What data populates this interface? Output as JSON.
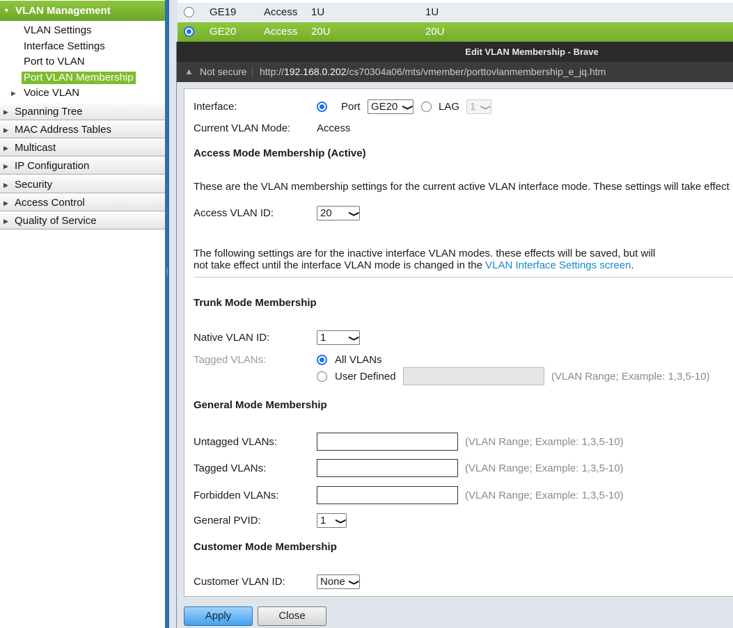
{
  "sidebar": {
    "active_section": "VLAN Management",
    "sub_items": [
      "VLAN Settings",
      "Interface Settings",
      "Port to VLAN",
      "Port VLAN Membership",
      "Voice VLAN"
    ],
    "sections": [
      "Spanning Tree",
      "MAC Address Tables",
      "Multicast",
      "IP Configuration",
      "Security",
      "Access Control",
      "Quality of Service"
    ]
  },
  "table": {
    "rows": [
      {
        "port": "GE19",
        "mode": "Access",
        "admin": "1U",
        "oper": "1U",
        "selected": false
      },
      {
        "port": "GE20",
        "mode": "Access",
        "admin": "20U",
        "oper": "20U",
        "selected": true
      }
    ]
  },
  "popup": {
    "title": "Edit VLAN Membership - Brave",
    "not_secure": "Not secure",
    "url_prefix": "http://",
    "url_host": "192.168.0.202",
    "url_path": "/cs70304a06/mts/vmember/porttovlanmembership_e_jq.htm"
  },
  "form": {
    "interface_label": "Interface:",
    "port_label": "Port",
    "port_value": "GE20",
    "lag_label": "LAG",
    "lag_value": "1",
    "current_mode_label": "Current VLAN Mode:",
    "current_mode_value": "Access",
    "access_head": "Access Mode Membership (Active)",
    "access_desc": "These are the VLAN membership settings for the current active VLAN interface mode. These settings will take effect i",
    "access_vlan_label": "Access VLAN ID:",
    "access_vlan_value": "20",
    "inactive_desc_1": "The following settings are for the inactive interface VLAN modes. these effects will be saved, but will",
    "inactive_desc_2": "not take effect until the interface VLAN mode is changed in the",
    "inactive_link": "VLAN Interface Settings screen",
    "inactive_period": ".",
    "trunk_head": "Trunk Mode Membership",
    "native_vlan_label": "Native VLAN ID:",
    "native_vlan_value": "1",
    "tagged_vlans_label": "Tagged VLANs:",
    "all_vlans_label": "All VLANs",
    "user_defined_label": "User Defined",
    "range_hint": "(VLAN Range; Example: 1,3,5-10)",
    "general_head": "General Mode Membership",
    "untagged_label": "Untagged VLANs:",
    "general_tagged_label": "Tagged VLANs:",
    "forbidden_label": "Forbidden VLANs:",
    "pvid_label": "General PVID:",
    "pvid_value": "1",
    "customer_head": "Customer Mode Membership",
    "customer_vlan_label": "Customer VLAN ID:",
    "customer_vlan_value": "None"
  },
  "buttons": {
    "apply": "Apply",
    "close": "Close"
  },
  "colors": {
    "accent_green": "#7cbc2e",
    "link_blue": "#1a87c9",
    "splitter_blue": "#2f6fb0"
  }
}
